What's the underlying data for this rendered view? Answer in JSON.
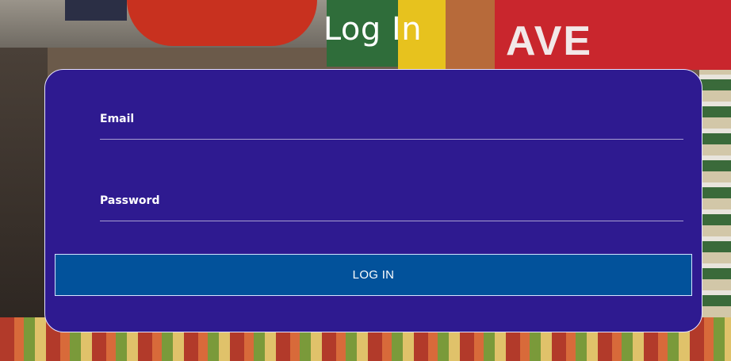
{
  "background": {
    "sign_text": "AVE"
  },
  "page": {
    "title": "Log In"
  },
  "form": {
    "email": {
      "label": "Email",
      "value": ""
    },
    "password": {
      "label": "Password",
      "value": ""
    },
    "submit_label": "LOG IN"
  },
  "colors": {
    "card": "#2e1a90",
    "button": "#02529b",
    "text": "#ffffff"
  }
}
